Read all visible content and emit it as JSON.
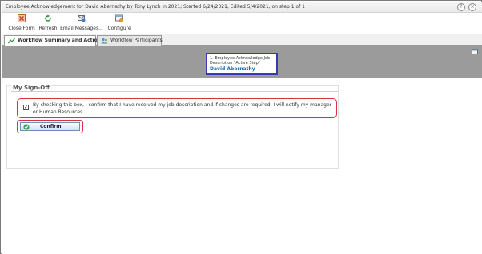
{
  "window": {
    "title": "Employee Acknowledgement for David Abernathy by Tony Lynch in 2021; Started 6/24/2021, Edited 5/4/2021, on step 1 of 1",
    "help_icon": "question-icon",
    "close_icon": "close-icon"
  },
  "toolbar": {
    "close_form": "Close Form",
    "refresh": "Refresh",
    "email": "Email Messages...",
    "configure": "Configure"
  },
  "tabs": [
    {
      "label": "Workflow Summary and Actions",
      "active": true
    },
    {
      "label": "Workflow Participants",
      "active": false
    }
  ],
  "step": {
    "title": "1. Employee Acknowledge Job Description \"Active Step\"",
    "person": "David Abernathy"
  },
  "signoff": {
    "section_title": "My Sign-Off",
    "checked": true,
    "ack_text": "By checking this box, I confirm that I have received my job description and if changes are required, I will notify my manager or Human Resources.",
    "confirm_label": "Confirm"
  },
  "colors": {
    "highlight": "#d8323f",
    "step_border": "#3a3ab0",
    "link": "#1b6aa8",
    "graybar": "#9b9b9b"
  }
}
